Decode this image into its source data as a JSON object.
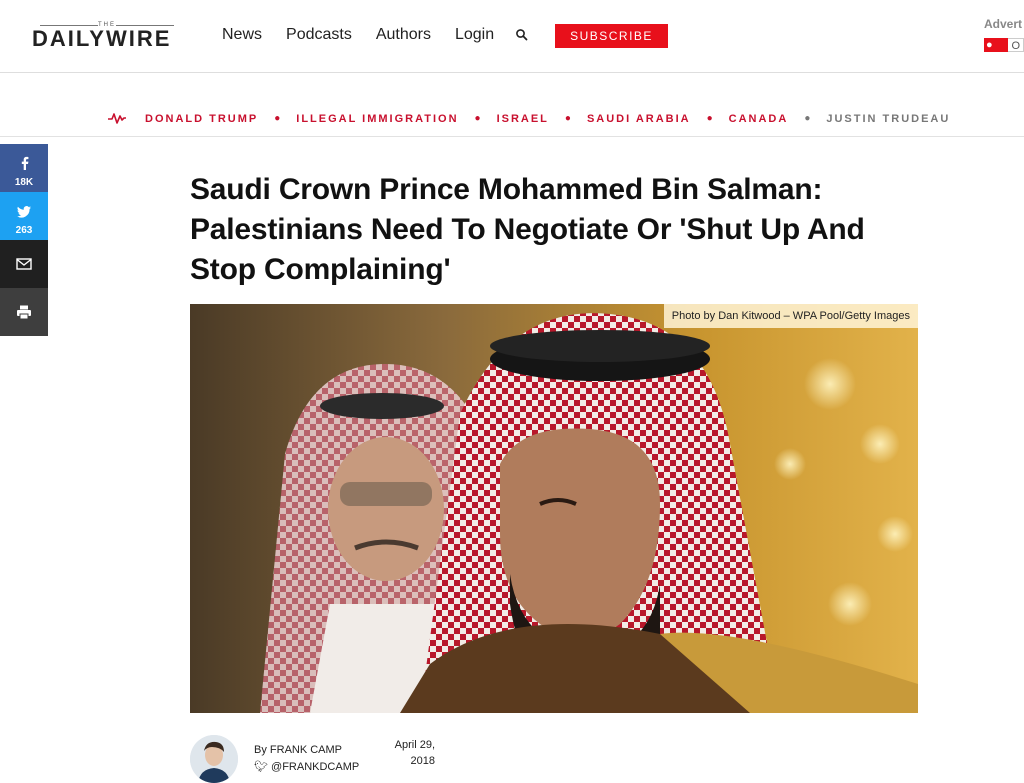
{
  "header": {
    "logo_small": "THE",
    "logo_word": "DAILYWIRE",
    "nav": [
      "News",
      "Podcasts",
      "Authors",
      "Login"
    ],
    "search_icon": "search-icon",
    "subscribe": "SUBSCRIBE",
    "ad_label": "Advert",
    "ad_on": "ON",
    "ad_off": "O",
    "accent": "#e8101b"
  },
  "trending": {
    "icon": "pulse-icon",
    "topics": [
      "DONALD TRUMP",
      "ILLEGAL IMMIGRATION",
      "ISRAEL",
      "SAUDI ARABIA",
      "CANADA",
      "JUSTIN TRUDEAU"
    ]
  },
  "share": {
    "facebook": {
      "icon": "facebook-icon",
      "count": "18K",
      "color": "#3b5998"
    },
    "twitter": {
      "icon": "twitter-icon",
      "count": "263",
      "color": "#1da1f2"
    },
    "email": {
      "icon": "email-icon"
    },
    "print": {
      "icon": "print-icon"
    }
  },
  "article": {
    "title": "Saudi Crown Prince Mohammed Bin Salman: Palestinians Need To Negotiate Or 'Shut Up And Stop Complaining'",
    "photo_credit": "Photo by Dan Kitwood – WPA Pool/Getty Images",
    "by_prefix": "By",
    "author": "FRANK CAMP",
    "handle": "@FRANKDCAMP",
    "date_line1": "April 29,",
    "date_line2": "2018"
  }
}
